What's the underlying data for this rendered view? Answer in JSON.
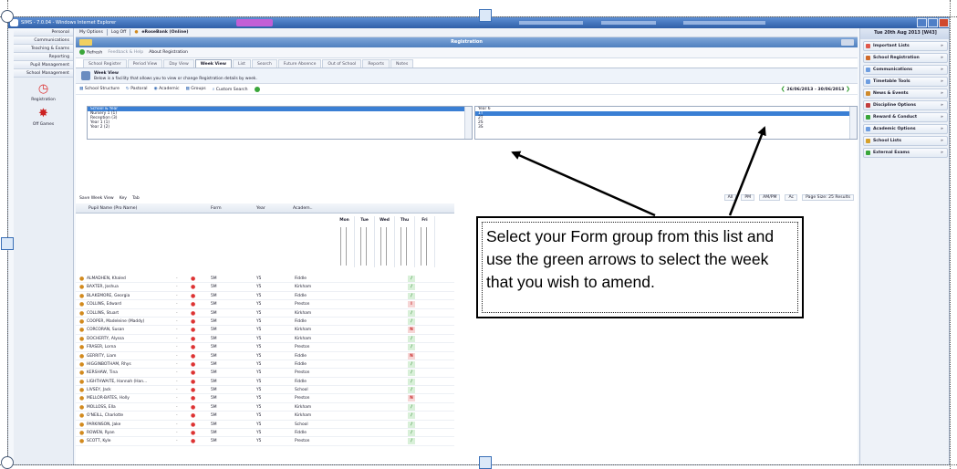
{
  "window": {
    "title": "SIMS - 7.0.04 - Windows Internet Explorer"
  },
  "left_nav": {
    "items": [
      "Personal",
      "Communications",
      "Teaching & Exams",
      "Reporting",
      "Pupil Management",
      "School Management"
    ],
    "tools": [
      {
        "label": "Registration",
        "icon": "clock-icon"
      },
      {
        "label": "Off Games",
        "icon": "rosette-icon"
      }
    ]
  },
  "menubar": {
    "items": [
      "My Options",
      "Log Off",
      "eRoseBank (Online)"
    ]
  },
  "header": {
    "title": "Registration"
  },
  "toolbar": {
    "refresh": "Refresh",
    "feedback": "Feedback & Help",
    "about": "About Registration"
  },
  "tabs": [
    "School Register",
    "Period View",
    "Day View",
    "Week View",
    "List",
    "Search",
    "Future Absence",
    "Out of School",
    "Reports",
    "Notes"
  ],
  "active_tab": "Week View",
  "info": {
    "title": "Week View",
    "text": "Below is a facility that allows you to view or change Registration details by week."
  },
  "filters": {
    "items": [
      "School Structure",
      "Pastoral",
      "Academic",
      "Groups",
      "Custom Search"
    ],
    "date_range": "26/06/2013 - 30/06/2013"
  },
  "lists": {
    "left_options": [
      "School & Year",
      "Nursery 1 (1)",
      "Reception (3)",
      "Year 1 (1)",
      "Year 2 (2)"
    ],
    "right_options": [
      "Year 6",
      "1T",
      "2T",
      "2S",
      "3S"
    ]
  },
  "grid_toolbar": {
    "left": [
      "Save Week View",
      "Key",
      "Tab"
    ],
    "right": [
      "All",
      "PM",
      "AM/PM",
      "Ac",
      "Page Size: 25 Results"
    ]
  },
  "grid": {
    "headers": [
      "Pupil Name (Pro Name)",
      "Form",
      "Year",
      "Academ.."
    ],
    "days": [
      "Mon",
      "Tue",
      "Wed",
      "Thu",
      "Fri"
    ],
    "rows": [
      {
        "name": "ALMADHEN, Khaled",
        "form": "5M",
        "year": "Y5",
        "ac": "Fiddle",
        "mark": "/"
      },
      {
        "name": "BAXTER, Joshua",
        "form": "5M",
        "year": "Y5",
        "ac": "Kirkham",
        "mark": "/"
      },
      {
        "name": "BLAKEMORE, Georgia",
        "form": "5M",
        "year": "Y5",
        "ac": "Fiddle",
        "mark": "/"
      },
      {
        "name": "COLLINS, Edward",
        "form": "5M",
        "year": "Y5",
        "ac": "Preston",
        "mark": "I"
      },
      {
        "name": "COLLINS, Stuart",
        "form": "5M",
        "year": "Y5",
        "ac": "Kirkham",
        "mark": "/"
      },
      {
        "name": "COOPER, Madeleine (Maddy)",
        "form": "5M",
        "year": "Y5",
        "ac": "Fiddle",
        "mark": "/"
      },
      {
        "name": "CORCORAN, Susan",
        "form": "5M",
        "year": "Y5",
        "ac": "Kirkham",
        "mark": "N"
      },
      {
        "name": "DOCHERTY, Alyssa",
        "form": "5M",
        "year": "Y5",
        "ac": "Kirkham",
        "mark": "/"
      },
      {
        "name": "FRASER, Lorna",
        "form": "5M",
        "year": "Y5",
        "ac": "Preston",
        "mark": "/"
      },
      {
        "name": "GERRITY, Liam",
        "form": "5M",
        "year": "Y5",
        "ac": "Fiddle",
        "mark": "N"
      },
      {
        "name": "HIGGINBOTHAM, Rhys",
        "form": "5M",
        "year": "Y5",
        "ac": "Fiddle",
        "mark": "/"
      },
      {
        "name": "KERSHAW, Tina",
        "form": "5M",
        "year": "Y5",
        "ac": "Preston",
        "mark": "/"
      },
      {
        "name": "LIGHTHWAITE, Hannah (Han...",
        "form": "5M",
        "year": "Y5",
        "ac": "Fiddle",
        "mark": "/"
      },
      {
        "name": "LIVSEY, Jack",
        "form": "5M",
        "year": "Y5",
        "ac": "School",
        "mark": "/"
      },
      {
        "name": "MELLOR-BATES, Holly",
        "form": "5M",
        "year": "Y5",
        "ac": "Preston",
        "mark": "N"
      },
      {
        "name": "MOLLOSS, Ella",
        "form": "5M",
        "year": "Y5",
        "ac": "Kirkham",
        "mark": "/"
      },
      {
        "name": "O'NEILL, Charlotte",
        "form": "5M",
        "year": "Y5",
        "ac": "Kirkham",
        "mark": "/"
      },
      {
        "name": "PARKINSON, Jake",
        "form": "5M",
        "year": "Y5",
        "ac": "School",
        "mark": "/"
      },
      {
        "name": "ROWEN, Ryan",
        "form": "5M",
        "year": "Y5",
        "ac": "Fiddle",
        "mark": "/"
      },
      {
        "name": "SCOTT, Kyle",
        "form": "5M",
        "year": "Y5",
        "ac": "Preston",
        "mark": "/"
      }
    ]
  },
  "right_panel": {
    "date": "Tue 20th Aug 2013 [W43]",
    "items": [
      "Important Lists",
      "School Registration",
      "Communications",
      "Timetable Tools",
      "News & Events",
      "Discipline Options",
      "Reward & Conduct",
      "Academic Options",
      "School Lists",
      "External Exams"
    ]
  },
  "callout": {
    "text": "Select your Form group from this list and use the green arrows to select the week that you wish to amend."
  },
  "colors": {
    "header_blue": "#4f7fbf",
    "selection_blue": "#3a7fd4",
    "present_green": "#2a8a2a",
    "absent_red": "#c33"
  }
}
